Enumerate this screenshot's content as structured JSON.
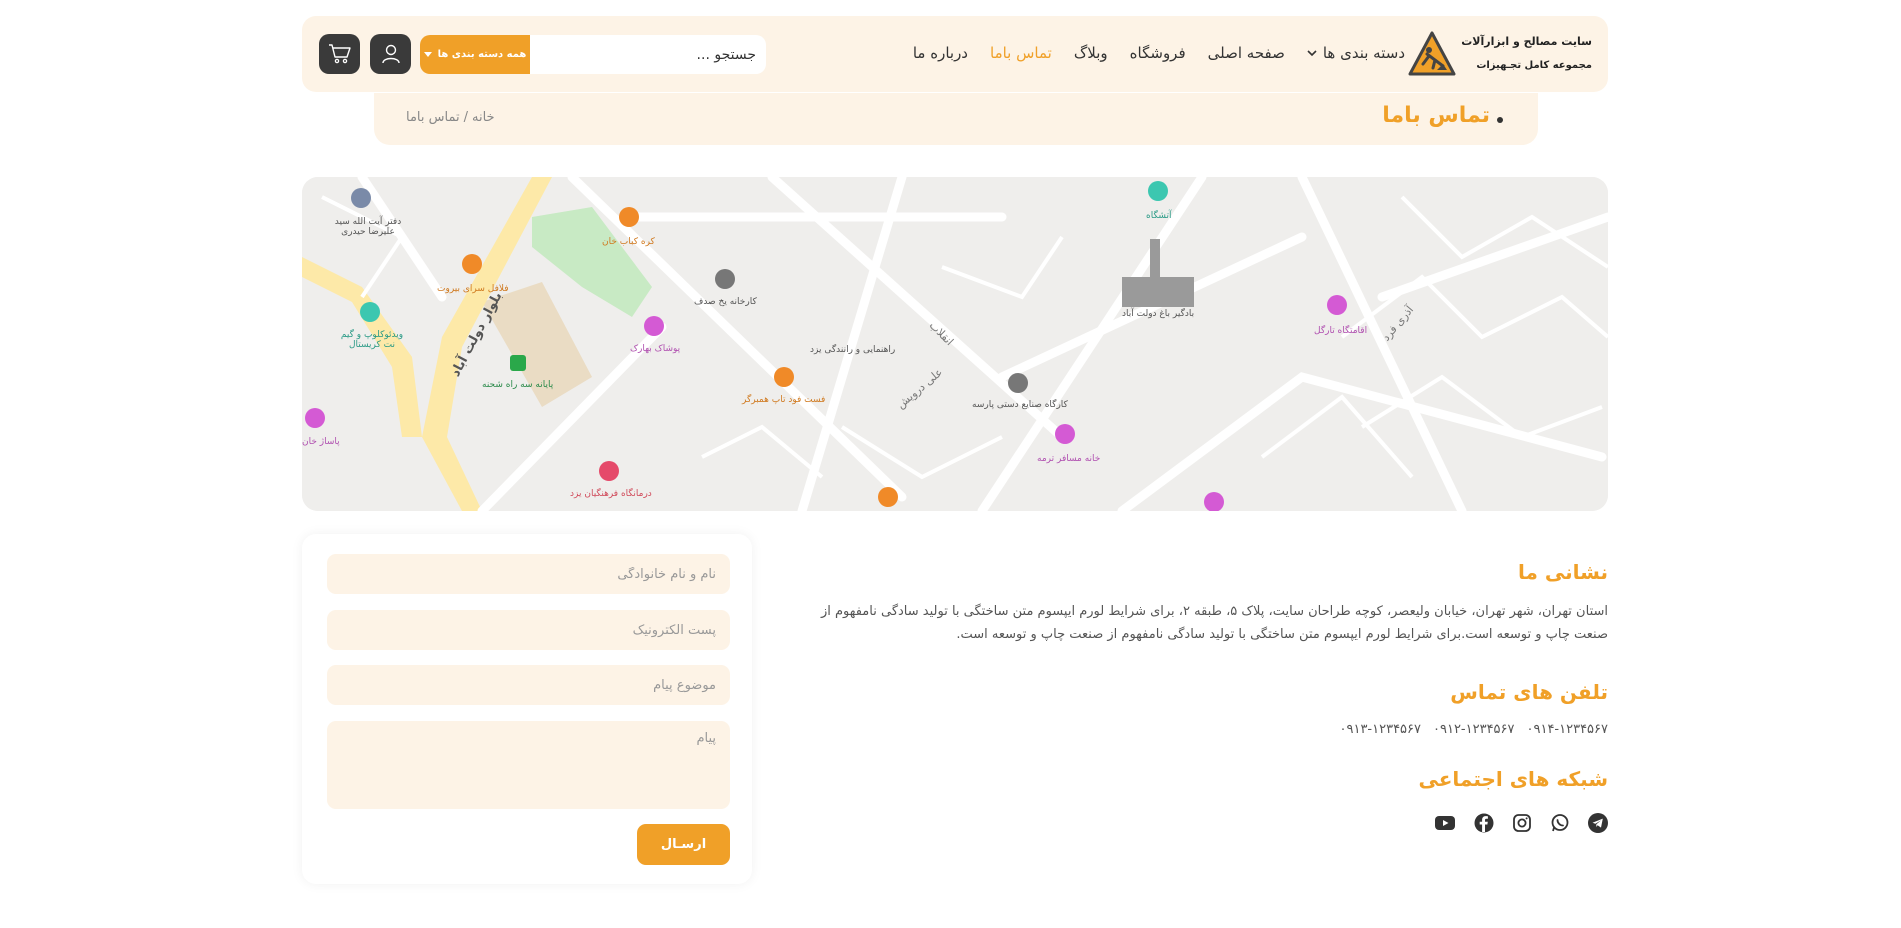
{
  "header": {
    "logo_title": "سایت مصالح و ابزارآلات",
    "logo_subtitle": "مجموعه کامل تجـهیزات",
    "nav": [
      {
        "label": "دسته بندی ها",
        "has_dropdown": true
      },
      {
        "label": "صفحه اصلی"
      },
      {
        "label": "فروشگاه"
      },
      {
        "label": "وبلاگ"
      },
      {
        "label": "تماس باما",
        "active": true
      },
      {
        "label": "درباره ما"
      }
    ],
    "search_placeholder": "جستجو ...",
    "category_button": "همه دسته بندی ها",
    "user_icon": "user-icon",
    "cart_icon": "cart-icon"
  },
  "breadcrumb": {
    "title": "تماس باما",
    "home": "خانه",
    "separator": "/",
    "current": "تماس باما"
  },
  "map": {
    "labels": [
      "دفتر آیت الله سید علیرضا حیدری",
      "کره کباب خان",
      "فلافل سرای بیروت",
      "ویدئوکلوپ و گیم نت کریستال",
      "پایانه سه راه شحنه",
      "بلوار دولت آباد",
      "پوشاک بهارک",
      "کارخانه یخ صدف",
      "راهنمایی و رانندگی یزد",
      "فست فود تاپ همبرگر",
      "درمانگاه فرهنگیان یزد",
      "کارگاه صنایع دستی پارسه",
      "خانه مسافر ترمه",
      "بادگیر باغ دولت آباد",
      "آتشگاه",
      "اقامتگاه تارگل",
      "پاساژ خان",
      "علی درویش",
      "انقلاب",
      "آذری فرد"
    ]
  },
  "contact": {
    "address_title": "نشانی ما",
    "address_text": "استان تهران، شهر تهران، خیابان ولیعصر، کوچه طراحان سایت، پلاک ۵، طبقه ۲، برای شرایط لورم ایپسوم متن ساختگی با تولید سادگی نامفهوم از صنعت چاپ و توسعه است.برای شرایط لورم ایپسوم متن ساختگی با تولید سادگی نامفهوم از صنعت چاپ و توسعه است.",
    "phones_title": "تلفن های تماس",
    "phones": [
      "۰۹۱۴-۱۲۳۴۵۶۷",
      "۰۹۱۲-۱۲۳۴۵۶۷",
      "۰۹۱۳-۱۲۳۴۵۶۷"
    ],
    "social_title": "شبکه های اجتماعی",
    "socials": [
      "telegram-icon",
      "whatsapp-icon",
      "instagram-icon",
      "facebook-icon",
      "youtube-icon"
    ]
  },
  "form": {
    "name_placeholder": "نام و نام خانوادگی",
    "email_placeholder": "پست الکترونیک",
    "subject_placeholder": "موضوع پیام",
    "message_placeholder": "پیام",
    "submit_label": "ارسـال"
  },
  "colors": {
    "accent": "#f0a028",
    "header_bg": "#fdf3e6",
    "dark_button": "#3a3a3a"
  }
}
